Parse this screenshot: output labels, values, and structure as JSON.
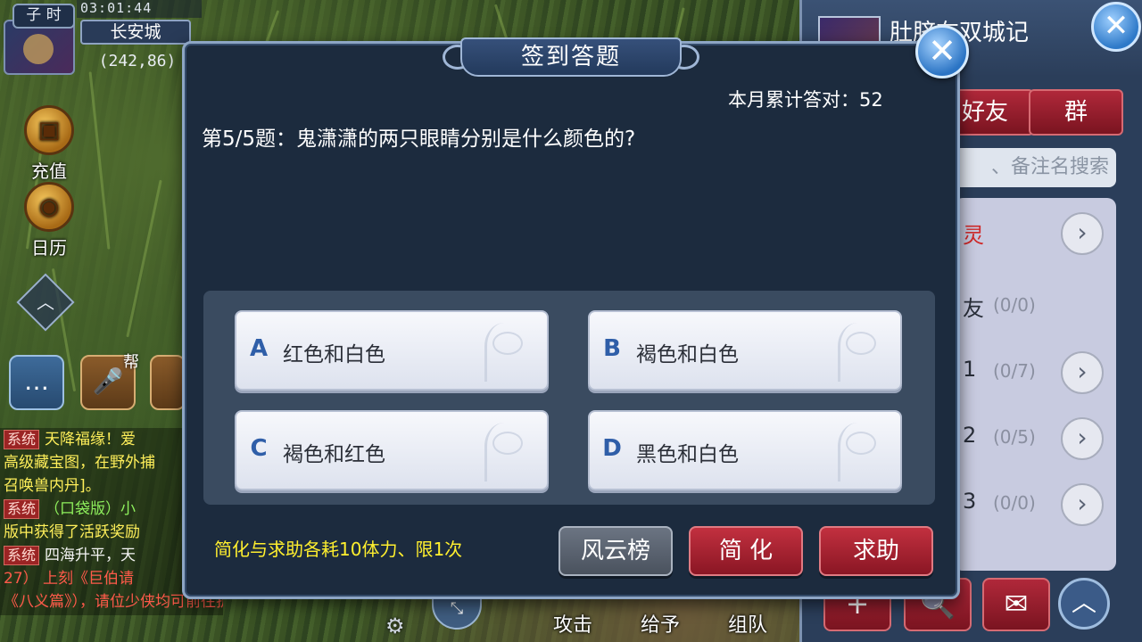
{
  "hud": {
    "time": "03:01:44",
    "shichen": "子 时",
    "map_name": "长安城",
    "coordinates": "(242,86)"
  },
  "left_menu": {
    "recharge": "充值",
    "calendar": "日历",
    "guild_label": "帮"
  },
  "chat_log": {
    "system_tag": "系统",
    "lines": [
      "天降福缘！爱",
      "高级藏宝图，在野外捕",
      "召唤兽内丹]。",
      "（口袋版）小",
      "版中获得了活跃奖励",
      "四海升平，天",
      "27）    上刻《巨伯请",
      "《八义篇》），请位少侠均可前往护印"
    ]
  },
  "bottom_bar": {
    "attack": "攻击",
    "give": "给予",
    "team": "组队"
  },
  "friend_panel": {
    "name": "肚脐在双城记",
    "subtitle": "",
    "close": "✕",
    "tab_friends": "好友",
    "tab_group": "群",
    "search_placeholder": "、备注名搜索",
    "rows": [
      {
        "label": "灵",
        "count": ""
      },
      {
        "label": "友",
        "count": "(0/0)"
      },
      {
        "label": "1",
        "count": "(0/7)"
      },
      {
        "label": "2",
        "count": "(0/5)"
      },
      {
        "label": "3",
        "count": "(0/0)"
      }
    ],
    "btn_add": "+",
    "btn_search": "🔍",
    "btn_mail": "✉",
    "btn_up": "︿"
  },
  "quiz": {
    "title": "签到答题",
    "close": "✕",
    "monthly_correct_label": "本月累计答对：",
    "monthly_correct_value": "52",
    "question": "第5/5题：鬼潇潇的两只眼睛分别是什么颜色的?",
    "options": [
      {
        "letter": "A",
        "text": "红色和白色"
      },
      {
        "letter": "B",
        "text": "褐色和白色"
      },
      {
        "letter": "C",
        "text": "褐色和红色"
      },
      {
        "letter": "D",
        "text": "黑色和白色"
      }
    ],
    "cost_note": "简化与求助各耗10体力、限1次",
    "btn_ranking": "风云榜",
    "btn_simplify": "简 化",
    "btn_help": "求助"
  }
}
